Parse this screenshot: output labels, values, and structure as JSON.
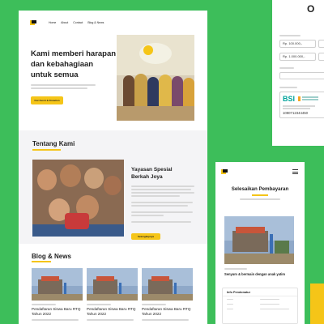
{
  "colors": {
    "background": "#3DBE5A",
    "accent": "#F5C518",
    "text": "#222222"
  },
  "nav": {
    "items": [
      "Home",
      "About",
      "Contact",
      "Blog & News"
    ]
  },
  "hero": {
    "title_lines": [
      "Kami memberi harapan",
      "dan kebahagiaan",
      "untuk semua"
    ],
    "cta": "Our Event & Donation"
  },
  "about": {
    "section_title": "Tentang Kami",
    "heading_lines": [
      "Yayasan Spesial",
      "Berkah Joya"
    ],
    "button": "Selengkapnya"
  },
  "blog": {
    "section_title": "Blog & News",
    "posts": [
      {
        "title_lines": [
          "Pendaftaran Siswa Baru RTQ",
          "Tahun 2022"
        ]
      },
      {
        "title_lines": [
          "Pendaftaran Siswa Baru RTQ",
          "Tahun 2022"
        ]
      },
      {
        "title_lines": [
          "Pendaftaran Siswa Baru RTQ",
          "Tahun 2022"
        ]
      }
    ]
  },
  "payment": {
    "header_partial": "O",
    "amounts": [
      "Rp. 100.000,-",
      "Rp. 1.000.000,-"
    ],
    "bank_logo": "BSI",
    "account_number": "1090712344450"
  },
  "mobile": {
    "title": "Selesaikan Pembayaran",
    "caption": "Senyum & bermain dengan anak yatim",
    "info_title": "Info Pendonatur"
  }
}
